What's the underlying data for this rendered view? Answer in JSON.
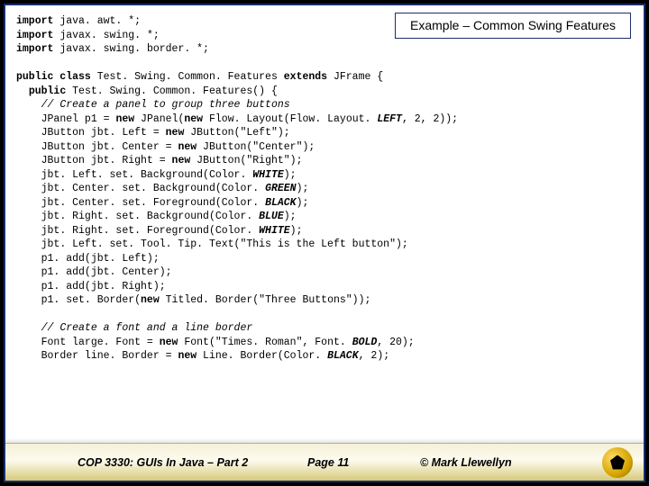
{
  "title": "Example – Common Swing Features",
  "code": {
    "imports": [
      {
        "kw": "import",
        "rest": " java. awt. *;"
      },
      {
        "kw": "import",
        "rest": " javax. swing. *;"
      },
      {
        "kw": "import",
        "rest": " javax. swing. border. *;"
      }
    ],
    "l1a": "public class",
    "l1b": " Test. Swing. Common. Features ",
    "l1c": "extends",
    "l1d": " JFrame {",
    "l2a": "public",
    "l2b": " Test. Swing. Common. Features() {",
    "l3": "// Create a panel to group three buttons",
    "l4a": "JPanel p1 = ",
    "l4b": "new",
    "l4c": " JPanel(",
    "l4d": "new",
    "l4e": " Flow. Layout(Flow. Layout. ",
    "l4f": "LEFT",
    "l4g": ", 2, 2));",
    "l5a": "JButton jbt. Left = ",
    "l5b": "new",
    "l5c": " JButton(\"Left\");",
    "l6a": "JButton jbt. Center = ",
    "l6b": "new",
    "l6c": " JButton(\"Center\");",
    "l7a": "JButton jbt. Right = ",
    "l7b": "new",
    "l7c": " JButton(\"Right\");",
    "l8a": "jbt. Left. set. Background(Color. ",
    "l8b": "WHITE",
    "l8c": ");",
    "l9a": "jbt. Center. set. Background(Color. ",
    "l9b": "GREEN",
    "l9c": ");",
    "l10a": "jbt. Center. set. Foreground(Color. ",
    "l10b": "BLACK",
    "l10c": ");",
    "l11a": "jbt. Right. set. Background(Color. ",
    "l11b": "BLUE",
    "l11c": ");",
    "l12a": "jbt. Right. set. Foreground(Color. ",
    "l12b": "WHITE",
    "l12c": ");",
    "l13": "jbt. Left. set. Tool. Tip. Text(\"This is the Left button\");",
    "l14": "p1. add(jbt. Left);",
    "l15": "p1. add(jbt. Center);",
    "l16": "p1. add(jbt. Right);",
    "l17a": "p1. set. Border(",
    "l17b": "new",
    "l17c": " Titled. Border(\"Three Buttons\"));",
    "l18": "// Create a font and a line border",
    "l19a": "Font large. Font = ",
    "l19b": "new",
    "l19c": " Font(\"Times. Roman\", Font. ",
    "l19d": "BOLD",
    "l19e": ", 20);",
    "l20a": "Border line. Border = ",
    "l20b": "new",
    "l20c": " Line. Border(Color. ",
    "l20d": "BLACK",
    "l20e": ", 2);"
  },
  "footer": {
    "left": "COP 3330:  GUIs In Java – Part 2",
    "mid": "Page 11",
    "right": "© Mark Llewellyn"
  }
}
